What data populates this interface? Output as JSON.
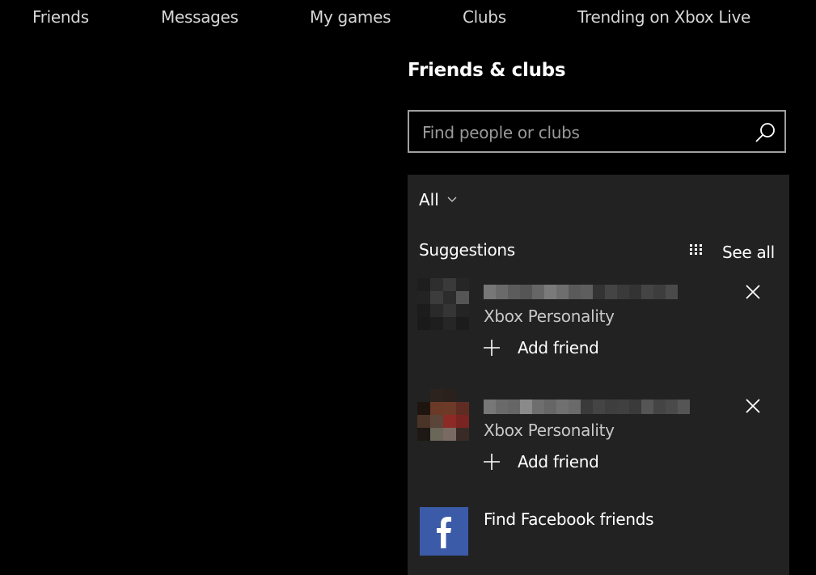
{
  "topnav": {
    "items": [
      {
        "label": "Friends"
      },
      {
        "label": "Messages"
      },
      {
        "label": "My games"
      },
      {
        "label": "Clubs"
      },
      {
        "label": "Trending on Xbox Live"
      }
    ]
  },
  "panel": {
    "title": "Friends & clubs",
    "search": {
      "placeholder": "Find people or clubs",
      "value": "",
      "icon": "search-icon"
    },
    "filter": {
      "selected": "All",
      "icon": "chevron-down-icon"
    },
    "suggestions": {
      "header": "Suggestions",
      "see_all_label": "See all",
      "grid_icon": "grid-icon",
      "items": [
        {
          "name": "[pixelated name]",
          "subtitle": "Xbox Personality",
          "action_label": "Add friend"
        },
        {
          "name": "[pixelated name]",
          "subtitle": "Xbox Personality",
          "action_label": "Add friend"
        }
      ]
    },
    "facebook": {
      "label": "Find Facebook friends",
      "icon": "facebook-icon",
      "brand_color": "#3b5aa8"
    }
  },
  "colors": {
    "background": "#000000",
    "card": "#222222",
    "nav_text": "#d6d6d6",
    "secondary_text": "#c8c8c8",
    "search_border": "#a0a0a0"
  }
}
